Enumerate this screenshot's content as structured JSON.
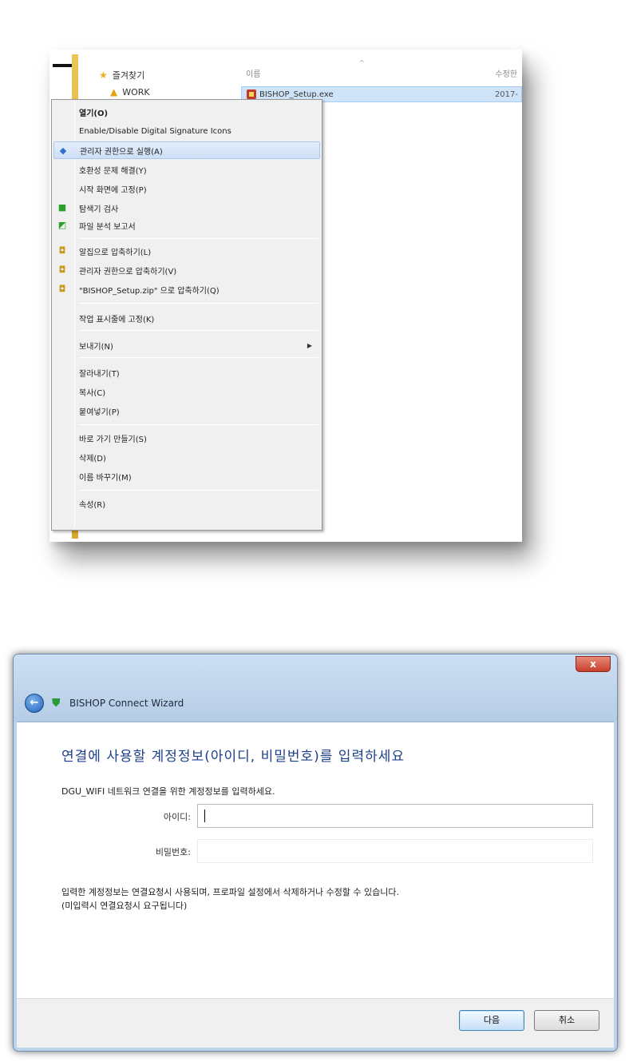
{
  "explorer": {
    "nav": [
      {
        "label": "즐겨찾기",
        "icon": "star-icon"
      },
      {
        "label": "WORK",
        "icon": "warning-icon"
      }
    ],
    "columns": {
      "name": "이름",
      "date": "수정한"
    },
    "file": {
      "name": "BISHOP_Setup.exe",
      "date": "2017-"
    },
    "context_menu": {
      "items": [
        {
          "label": "열기(O)"
        },
        {
          "label": "Enable/Disable Digital Signature Icons"
        },
        {
          "label": "관리자 권한으로 실행(A)"
        },
        {
          "label": "호환성 문제 해결(Y)"
        },
        {
          "label": "시작 화면에 고정(P)"
        },
        {
          "label": "탐색기 검사"
        },
        {
          "label": "파일 분석 보고서"
        },
        {
          "label": "알집으로 압축하기(L)"
        },
        {
          "label": "관리자 권한으로 압축하기(V)"
        },
        {
          "label": "\"BISHOP_Setup.zip\" 으로 압축하기(Q)"
        },
        {
          "label": "작업 표시줄에 고정(K)"
        },
        {
          "label": "보내기(N)"
        },
        {
          "label": "잘라내기(T)"
        },
        {
          "label": "복사(C)"
        },
        {
          "label": "붙여넣기(P)"
        },
        {
          "label": "바로 가기 만들기(S)"
        },
        {
          "label": "삭제(D)"
        },
        {
          "label": "이름 바꾸기(M)"
        },
        {
          "label": "속성(R)"
        }
      ]
    }
  },
  "dialog": {
    "close_label": "x",
    "app_title": "BISHOP Connect Wizard",
    "heading": "연결에 사용할 계정정보(아이디, 비밀번호)를 입력하세요",
    "description": "DGU_WIFI 네트워크 연결을 위한 계정정보를 입력하세요.",
    "id_label": "아이디:",
    "id_value": "",
    "password_label": "비밀번호:",
    "password_value": "",
    "note_line1": "입력한 계정정보는 연결요청시 사용되며, 프로파일 설정에서 삭제하거나 수정할 수 있습니다.",
    "note_line2": "(미입력시 연결요청시 요구됩니다)",
    "next_label": "다음",
    "cancel_label": "취소"
  }
}
